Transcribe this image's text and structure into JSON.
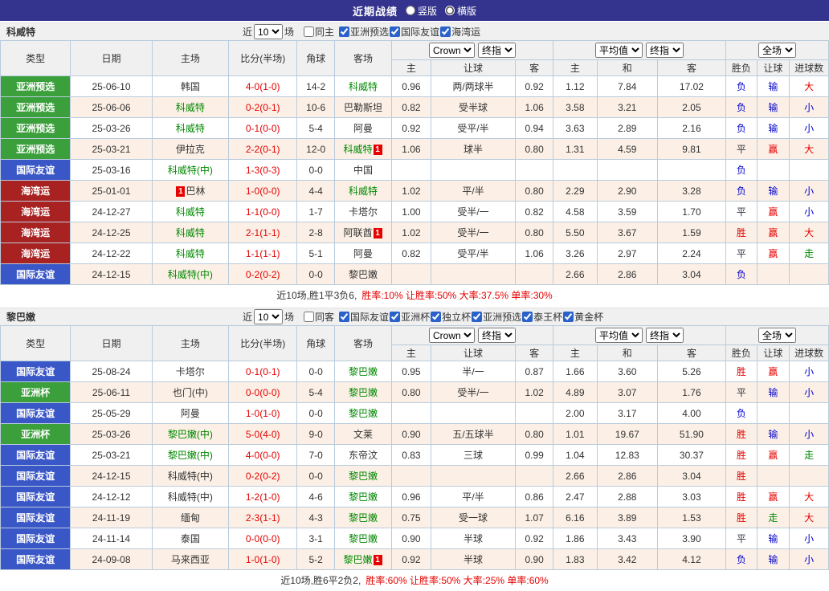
{
  "topbar": {
    "title": "近期战绩",
    "radios": [
      {
        "label": "竖版",
        "selected": false
      },
      {
        "label": "横版",
        "selected": true
      }
    ]
  },
  "colors": {
    "topbar_bg": "#34348E",
    "row_alt_bg": "#FCF0E6",
    "grid_border": "#B9CBDC",
    "focus_team": "#008800",
    "score": "#E60000"
  },
  "type_colors": {
    "亚洲预选": "#3BA03B",
    "亚洲杯": "#3BA03B",
    "国际友谊": "#3A57C8",
    "海湾运": "#A92222"
  },
  "result_colors": {
    "胜": "#E60000",
    "赢": "#E60000",
    "大": "#E60000",
    "负": "#0000CC",
    "输": "#0000CC",
    "小": "#0000CC",
    "走": "#008800",
    "平": "#333344"
  },
  "table_header": {
    "main_cols": [
      "类型",
      "日期",
      "主场",
      "比分(半场)",
      "角球",
      "客场"
    ],
    "group_selects": [
      [
        "Crown",
        "终指"
      ],
      [
        "平均值",
        "终指"
      ],
      [
        "全场"
      ]
    ],
    "sub_cols": [
      "主",
      "让球",
      "客",
      "主",
      "和",
      "客",
      "胜负",
      "让球",
      "进球数"
    ]
  },
  "sections": [
    {
      "team": "科威特",
      "filters": {
        "near": "近",
        "count": "10",
        "games": "场",
        "same": {
          "label": "同主",
          "checked": false
        },
        "comps": [
          {
            "label": "亚洲预选",
            "checked": true
          },
          {
            "label": "国际友谊",
            "checked": true
          },
          {
            "label": "海湾运",
            "checked": true
          }
        ]
      },
      "rows": [
        {
          "type": "亚洲预选",
          "date": "25-06-10",
          "home": {
            "name": "韩国"
          },
          "score": "4-0(1-0)",
          "corner": "14-2",
          "away": {
            "name": "科威特",
            "focus": true
          },
          "odds": [
            "0.96",
            "两/两球半",
            "0.92",
            "1.12",
            "7.84",
            "17.02"
          ],
          "results": [
            "负",
            "输",
            "大"
          ]
        },
        {
          "type": "亚洲预选",
          "date": "25-06-06",
          "home": {
            "name": "科威特",
            "focus": true
          },
          "score": "0-2(0-1)",
          "corner": "10-6",
          "away": {
            "name": "巴勒斯坦"
          },
          "odds": [
            "0.82",
            "受半球",
            "1.06",
            "3.58",
            "3.21",
            "2.05"
          ],
          "results": [
            "负",
            "输",
            "小"
          ]
        },
        {
          "type": "亚洲预选",
          "date": "25-03-26",
          "home": {
            "name": "科威特",
            "focus": true
          },
          "score": "0-1(0-0)",
          "corner": "5-4",
          "away": {
            "name": "阿曼"
          },
          "odds": [
            "0.92",
            "受平/半",
            "0.94",
            "3.63",
            "2.89",
            "2.16"
          ],
          "results": [
            "负",
            "输",
            "小"
          ]
        },
        {
          "type": "亚洲预选",
          "date": "25-03-21",
          "home": {
            "name": "伊拉克"
          },
          "score": "2-2(0-1)",
          "corner": "12-0",
          "away": {
            "name": "科威特",
            "focus": true,
            "red_card": "after"
          },
          "odds": [
            "1.06",
            "球半",
            "0.80",
            "1.31",
            "4.59",
            "9.81"
          ],
          "results": [
            "平",
            "赢",
            "大"
          ]
        },
        {
          "type": "国际友谊",
          "date": "25-03-16",
          "home": {
            "name": "科威特(中)",
            "focus": true
          },
          "score": "1-3(0-3)",
          "corner": "0-0",
          "away": {
            "name": "中国"
          },
          "odds": [
            "",
            "",
            "",
            "",
            "",
            ""
          ],
          "results": [
            "负",
            "",
            ""
          ]
        },
        {
          "type": "海湾运",
          "date": "25-01-01",
          "home": {
            "name": "巴林",
            "red_card": "before"
          },
          "score": "1-0(0-0)",
          "corner": "4-4",
          "away": {
            "name": "科威特",
            "focus": true
          },
          "odds": [
            "1.02",
            "平/半",
            "0.80",
            "2.29",
            "2.90",
            "3.28"
          ],
          "results": [
            "负",
            "输",
            "小"
          ]
        },
        {
          "type": "海湾运",
          "date": "24-12-27",
          "home": {
            "name": "科威特",
            "focus": true
          },
          "score": "1-1(0-0)",
          "corner": "1-7",
          "away": {
            "name": "卡塔尔"
          },
          "odds": [
            "1.00",
            "受半/一",
            "0.82",
            "4.58",
            "3.59",
            "1.70"
          ],
          "results": [
            "平",
            "赢",
            "小"
          ]
        },
        {
          "type": "海湾运",
          "date": "24-12-25",
          "home": {
            "name": "科威特",
            "focus": true
          },
          "score": "2-1(1-1)",
          "corner": "2-8",
          "away": {
            "name": "阿联酋",
            "red_card": "after"
          },
          "odds": [
            "1.02",
            "受半/一",
            "0.80",
            "5.50",
            "3.67",
            "1.59"
          ],
          "results": [
            "胜",
            "赢",
            "大"
          ]
        },
        {
          "type": "海湾运",
          "date": "24-12-22",
          "home": {
            "name": "科威特",
            "focus": true
          },
          "score": "1-1(1-1)",
          "corner": "5-1",
          "away": {
            "name": "阿曼"
          },
          "odds": [
            "0.82",
            "受平/半",
            "1.06",
            "3.26",
            "2.97",
            "2.24"
          ],
          "results": [
            "平",
            "赢",
            "走"
          ]
        },
        {
          "type": "国际友谊",
          "date": "24-12-15",
          "home": {
            "name": "科威特(中)",
            "focus": true
          },
          "score": "0-2(0-2)",
          "corner": "0-0",
          "away": {
            "name": "黎巴嫩"
          },
          "odds": [
            "",
            "",
            "",
            "2.66",
            "2.86",
            "3.04"
          ],
          "results": [
            "负",
            "",
            ""
          ]
        }
      ],
      "summary": {
        "record": "近10场,胜1平3负6,",
        "rates": "胜率:10% 让胜率:50% 大率:37.5% 单率:30%"
      }
    },
    {
      "team": "黎巴嫩",
      "filters": {
        "near": "近",
        "count": "10",
        "games": "场",
        "same": {
          "label": "同客",
          "checked": false
        },
        "comps": [
          {
            "label": "国际友谊",
            "checked": true
          },
          {
            "label": "亚洲杯",
            "checked": true
          },
          {
            "label": "独立杯",
            "checked": true
          },
          {
            "label": "亚洲预选",
            "checked": true
          },
          {
            "label": "泰王杯",
            "checked": true
          },
          {
            "label": "黄金杯",
            "checked": true
          }
        ]
      },
      "rows": [
        {
          "type": "国际友谊",
          "date": "25-08-24",
          "home": {
            "name": "卡塔尔"
          },
          "score": "0-1(0-1)",
          "corner": "0-0",
          "away": {
            "name": "黎巴嫩",
            "focus": true
          },
          "odds": [
            "0.95",
            "半/一",
            "0.87",
            "1.66",
            "3.60",
            "5.26"
          ],
          "results": [
            "胜",
            "赢",
            "小"
          ]
        },
        {
          "type": "亚洲杯",
          "date": "25-06-11",
          "home": {
            "name": "也门(中)"
          },
          "score": "0-0(0-0)",
          "corner": "5-4",
          "away": {
            "name": "黎巴嫩",
            "focus": true
          },
          "odds": [
            "0.80",
            "受半/一",
            "1.02",
            "4.89",
            "3.07",
            "1.76"
          ],
          "results": [
            "平",
            "输",
            "小"
          ]
        },
        {
          "type": "国际友谊",
          "date": "25-05-29",
          "home": {
            "name": "阿曼"
          },
          "score": "1-0(1-0)",
          "corner": "0-0",
          "away": {
            "name": "黎巴嫩",
            "focus": true
          },
          "odds": [
            "",
            "",
            "",
            "2.00",
            "3.17",
            "4.00"
          ],
          "results": [
            "负",
            "",
            ""
          ]
        },
        {
          "type": "亚洲杯",
          "date": "25-03-26",
          "home": {
            "name": "黎巴嫩(中)",
            "focus": true
          },
          "score": "5-0(4-0)",
          "corner": "9-0",
          "away": {
            "name": "文莱"
          },
          "odds": [
            "0.90",
            "五/五球半",
            "0.80",
            "1.01",
            "19.67",
            "51.90"
          ],
          "results": [
            "胜",
            "输",
            "小"
          ]
        },
        {
          "type": "国际友谊",
          "date": "25-03-21",
          "home": {
            "name": "黎巴嫩(中)",
            "focus": true
          },
          "score": "4-0(0-0)",
          "corner": "7-0",
          "away": {
            "name": "东帝汶"
          },
          "odds": [
            "0.83",
            "三球",
            "0.99",
            "1.04",
            "12.83",
            "30.37"
          ],
          "results": [
            "胜",
            "赢",
            "走"
          ]
        },
        {
          "type": "国际友谊",
          "date": "24-12-15",
          "home": {
            "name": "科威特(中)"
          },
          "score": "0-2(0-2)",
          "corner": "0-0",
          "away": {
            "name": "黎巴嫩",
            "focus": true
          },
          "odds": [
            "",
            "",
            "",
            "2.66",
            "2.86",
            "3.04"
          ],
          "results": [
            "胜",
            "",
            ""
          ]
        },
        {
          "type": "国际友谊",
          "date": "24-12-12",
          "home": {
            "name": "科威特(中)"
          },
          "score": "1-2(1-0)",
          "corner": "4-6",
          "away": {
            "name": "黎巴嫩",
            "focus": true
          },
          "odds": [
            "0.96",
            "平/半",
            "0.86",
            "2.47",
            "2.88",
            "3.03"
          ],
          "results": [
            "胜",
            "赢",
            "大"
          ]
        },
        {
          "type": "国际友谊",
          "date": "24-11-19",
          "home": {
            "name": "缅甸"
          },
          "score": "2-3(1-1)",
          "corner": "4-3",
          "away": {
            "name": "黎巴嫩",
            "focus": true
          },
          "odds": [
            "0.75",
            "受一球",
            "1.07",
            "6.16",
            "3.89",
            "1.53"
          ],
          "results": [
            "胜",
            "走",
            "大"
          ]
        },
        {
          "type": "国际友谊",
          "date": "24-11-14",
          "home": {
            "name": "泰国"
          },
          "score": "0-0(0-0)",
          "corner": "3-1",
          "away": {
            "name": "黎巴嫩",
            "focus": true
          },
          "odds": [
            "0.90",
            "半球",
            "0.92",
            "1.86",
            "3.43",
            "3.90"
          ],
          "results": [
            "平",
            "输",
            "小"
          ]
        },
        {
          "type": "国际友谊",
          "date": "24-09-08",
          "home": {
            "name": "马来西亚"
          },
          "score": "1-0(1-0)",
          "corner": "5-2",
          "away": {
            "name": "黎巴嫩",
            "focus": true,
            "red_card": "after"
          },
          "odds": [
            "0.92",
            "半球",
            "0.90",
            "1.83",
            "3.42",
            "4.12"
          ],
          "results": [
            "负",
            "输",
            "小"
          ]
        }
      ],
      "summary": {
        "record": "近10场,胜6平2负2,",
        "rates": "胜率:60% 让胜率:50% 大率:25% 单率:60%"
      }
    }
  ]
}
